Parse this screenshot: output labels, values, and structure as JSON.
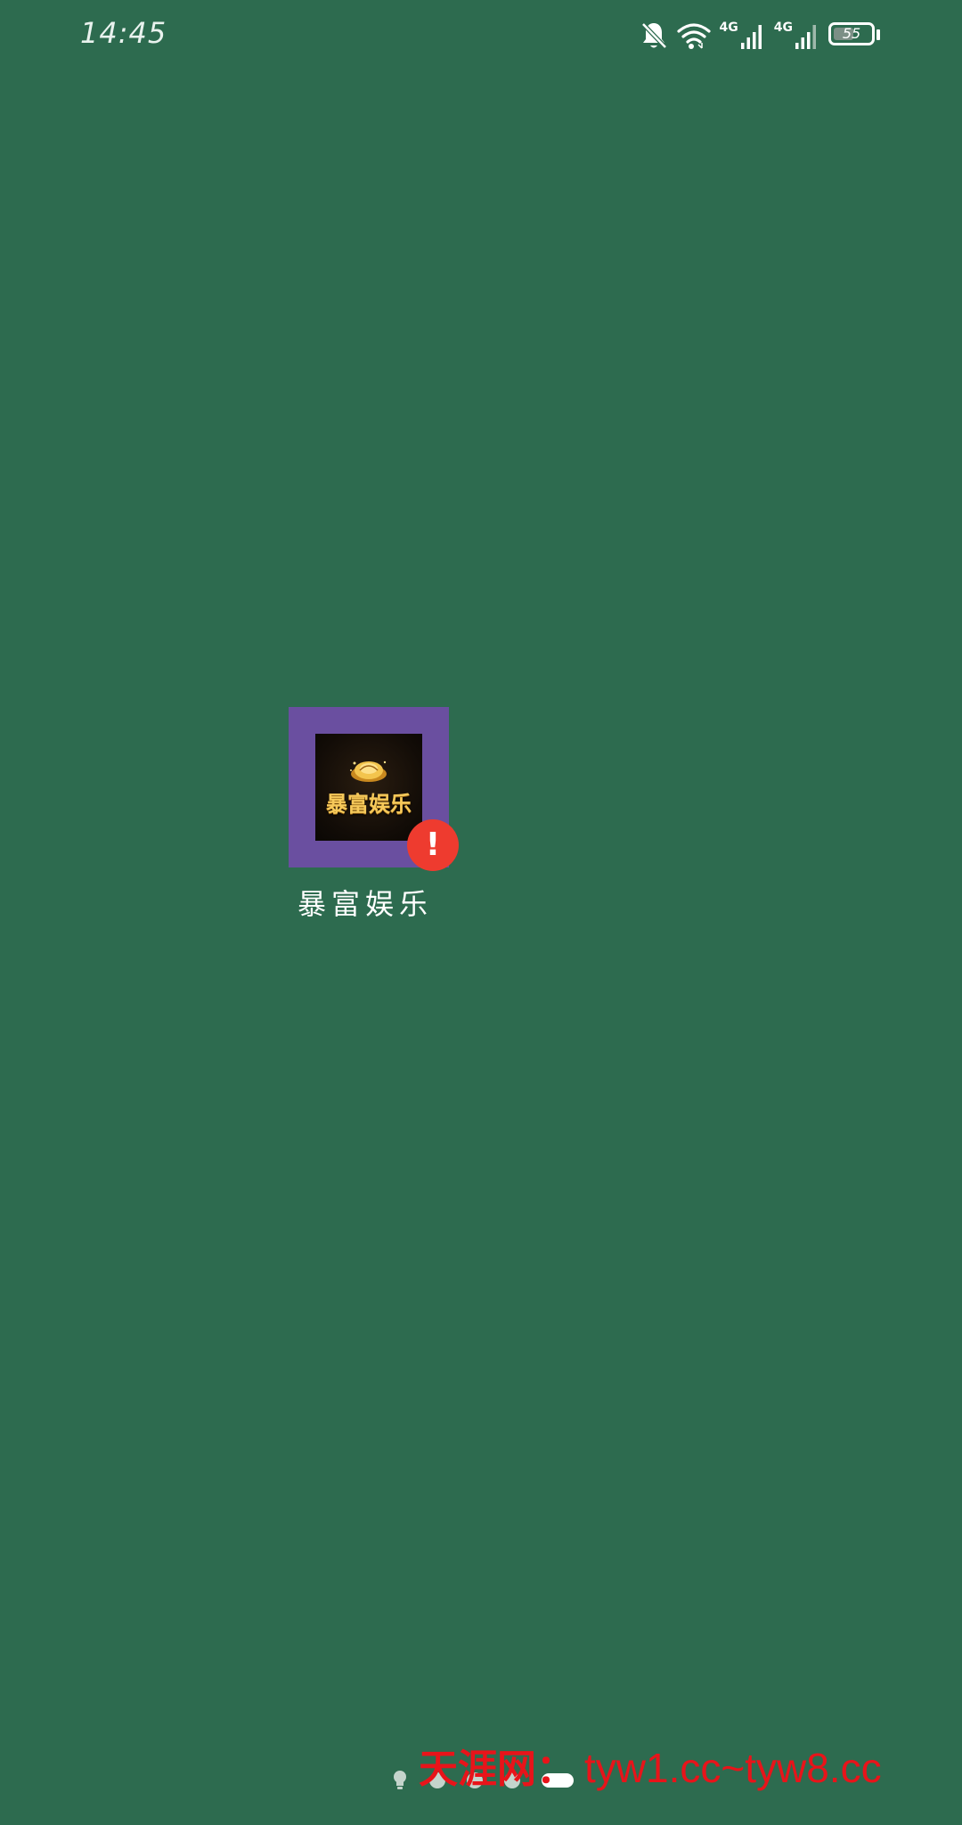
{
  "status_bar": {
    "time": "14:45",
    "network_label_1": "4G",
    "network_label_2": "4G",
    "battery_level": "55",
    "battery_percent": 55,
    "icons": [
      "bell-off-icon",
      "wifi-icon",
      "signal-icon",
      "signal-icon",
      "battery-icon"
    ]
  },
  "home_screen": {
    "background_color": "#2d6b4f",
    "app": {
      "name": "暴富娱乐",
      "icon_text": "暴富娱乐",
      "icon_frame_color": "#6a4fa0",
      "badge_text": "!",
      "badge_color": "#ee3b2f"
    },
    "page_indicator": {
      "pages": 5,
      "active_index": 4
    }
  },
  "watermark": {
    "text_cn": "天涯网：",
    "text_url": "tyw1.cc~tyw8.cc",
    "color": "#e8141a"
  }
}
